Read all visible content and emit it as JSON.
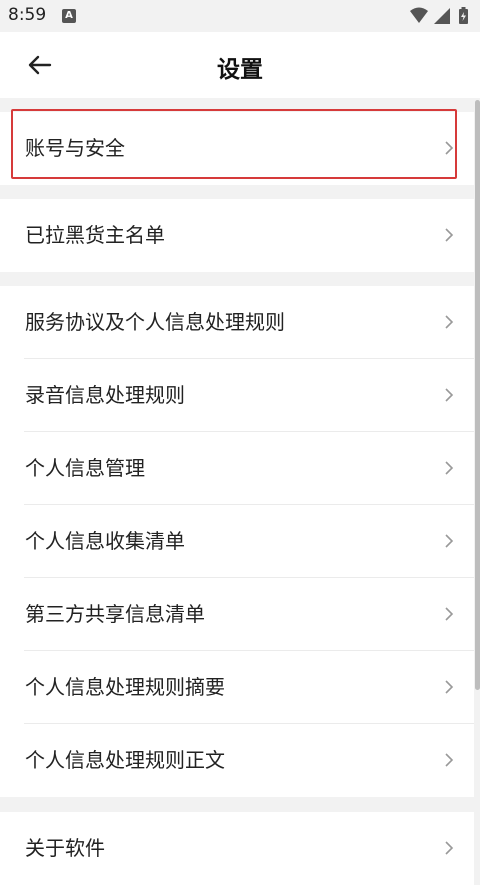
{
  "status_bar": {
    "time": "8:59",
    "notification_icon_letter": "A",
    "icons": [
      "wifi-icon",
      "signal-icon",
      "battery-icon"
    ]
  },
  "header": {
    "title": "设置",
    "back_icon": "arrow-left-icon"
  },
  "sections": [
    {
      "items": [
        {
          "label": "账号与安全",
          "highlighted": true
        }
      ]
    },
    {
      "items": [
        {
          "label": "已拉黑货主名单"
        }
      ]
    },
    {
      "items": [
        {
          "label": "服务协议及个人信息处理规则"
        },
        {
          "label": "录音信息处理规则"
        },
        {
          "label": "个人信息管理"
        },
        {
          "label": "个人信息收集清单"
        },
        {
          "label": "第三方共享信息清单"
        },
        {
          "label": "个人信息处理规则摘要"
        },
        {
          "label": "个人信息处理规则正文"
        }
      ]
    },
    {
      "items": [
        {
          "label": "关于软件"
        }
      ]
    }
  ],
  "colors": {
    "background": "#f2f2f2",
    "highlight_border": "#d63a3a",
    "chevron": "#999999"
  }
}
